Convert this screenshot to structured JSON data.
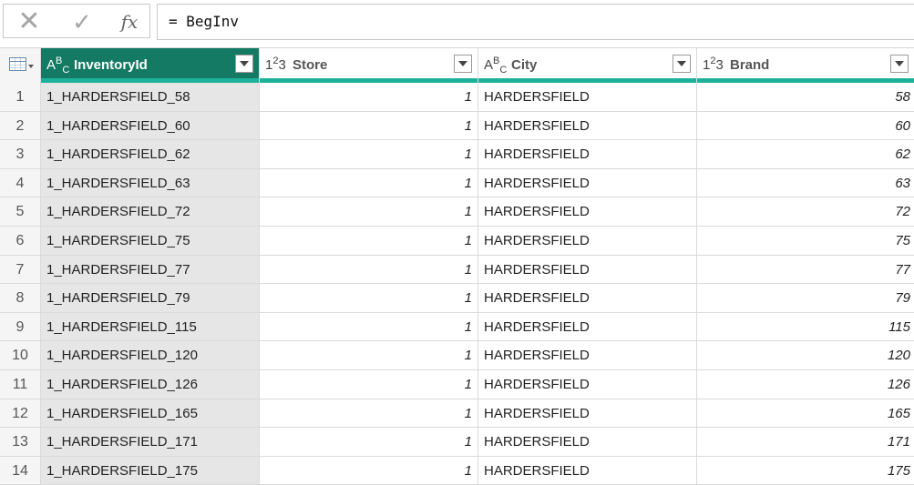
{
  "formula_bar": {
    "cancel_icon": "x-icon",
    "commit_icon": "check-icon",
    "fx_label": "fx",
    "formula": "= BegInv"
  },
  "columns": [
    {
      "type_icon": "ABC",
      "name": "InventoryId",
      "selected": true
    },
    {
      "type_icon": "123",
      "name": "Store"
    },
    {
      "type_icon": "ABC",
      "name": "City"
    },
    {
      "type_icon": "123",
      "name": "Brand"
    }
  ],
  "rows": [
    {
      "num": "1",
      "inventory_id": "1_HARDERSFIELD_58",
      "store": "1",
      "city": "HARDERSFIELD",
      "brand": "58"
    },
    {
      "num": "2",
      "inventory_id": "1_HARDERSFIELD_60",
      "store": "1",
      "city": "HARDERSFIELD",
      "brand": "60"
    },
    {
      "num": "3",
      "inventory_id": "1_HARDERSFIELD_62",
      "store": "1",
      "city": "HARDERSFIELD",
      "brand": "62"
    },
    {
      "num": "4",
      "inventory_id": "1_HARDERSFIELD_63",
      "store": "1",
      "city": "HARDERSFIELD",
      "brand": "63"
    },
    {
      "num": "5",
      "inventory_id": "1_HARDERSFIELD_72",
      "store": "1",
      "city": "HARDERSFIELD",
      "brand": "72"
    },
    {
      "num": "6",
      "inventory_id": "1_HARDERSFIELD_75",
      "store": "1",
      "city": "HARDERSFIELD",
      "brand": "75"
    },
    {
      "num": "7",
      "inventory_id": "1_HARDERSFIELD_77",
      "store": "1",
      "city": "HARDERSFIELD",
      "brand": "77"
    },
    {
      "num": "8",
      "inventory_id": "1_HARDERSFIELD_79",
      "store": "1",
      "city": "HARDERSFIELD",
      "brand": "79"
    },
    {
      "num": "9",
      "inventory_id": "1_HARDERSFIELD_115",
      "store": "1",
      "city": "HARDERSFIELD",
      "brand": "115"
    },
    {
      "num": "10",
      "inventory_id": "1_HARDERSFIELD_120",
      "store": "1",
      "city": "HARDERSFIELD",
      "brand": "120"
    },
    {
      "num": "11",
      "inventory_id": "1_HARDERSFIELD_126",
      "store": "1",
      "city": "HARDERSFIELD",
      "brand": "126"
    },
    {
      "num": "12",
      "inventory_id": "1_HARDERSFIELD_165",
      "store": "1",
      "city": "HARDERSFIELD",
      "brand": "165"
    },
    {
      "num": "13",
      "inventory_id": "1_HARDERSFIELD_171",
      "store": "1",
      "city": "HARDERSFIELD",
      "brand": "171"
    },
    {
      "num": "14",
      "inventory_id": "1_HARDERSFIELD_175",
      "store": "1",
      "city": "HARDERSFIELD",
      "brand": "175"
    }
  ],
  "colors": {
    "selected_header": "#147a63",
    "type_line": "#1fb29b",
    "selected_column_fill": "#e6e6e6"
  }
}
